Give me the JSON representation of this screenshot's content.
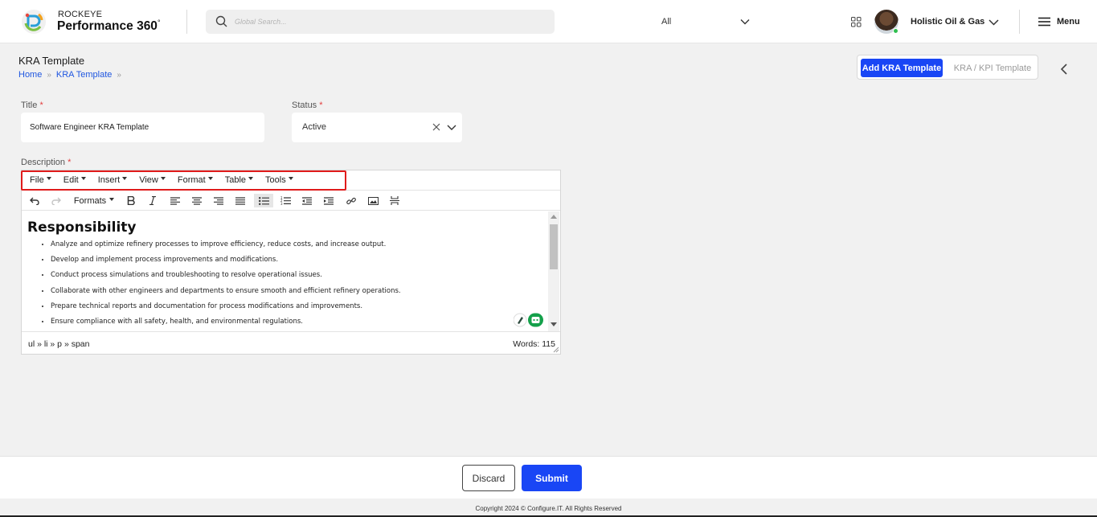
{
  "header": {
    "brand_small": "ROCKEYE",
    "brand_big": "Performance 360",
    "brand_degree": "°",
    "search_placeholder": "Global Search...",
    "search_scope": "All",
    "org_name": "Holistic Oil & Gas",
    "menu_label": "Menu"
  },
  "page": {
    "title": "KRA Template",
    "breadcrumb": [
      "Home",
      "KRA Template"
    ],
    "toggle_active": "Add KRA Template",
    "toggle_inactive": "KRA / KPI Template"
  },
  "form": {
    "title_label": "Title",
    "title_value": "Software Engineer KRA Template",
    "status_label": "Status",
    "status_value": "Active",
    "required_mark": "*",
    "description_label": "Description"
  },
  "editor": {
    "menus": [
      "File",
      "Edit",
      "Insert",
      "View",
      "Format",
      "Table",
      "Tools"
    ],
    "formats_label": "Formats",
    "heading": "Responsibility",
    "bullets": [
      "Analyze and optimize refinery processes to improve efficiency, reduce costs, and increase output.",
      "Develop and implement process improvements and modifications.",
      "Conduct process simulations and troubleshooting to resolve operational issues.",
      "Collaborate with other engineers and departments to ensure smooth and efficient refinery operations.",
      "Prepare technical reports and documentation for process modifications and improvements.",
      "Ensure compliance with all safety, health, and environmental regulations."
    ],
    "element_path": "ul » li » p » span",
    "word_count": "Words: 115"
  },
  "footer": {
    "discard_label": "Discard",
    "submit_label": "Submit",
    "copyright": "Copyright 2024 © Configure.IT. All Rights Reserved"
  },
  "colors": {
    "primary": "#1946f5",
    "highlight": "#e01b1b",
    "link": "#1f56e0"
  }
}
